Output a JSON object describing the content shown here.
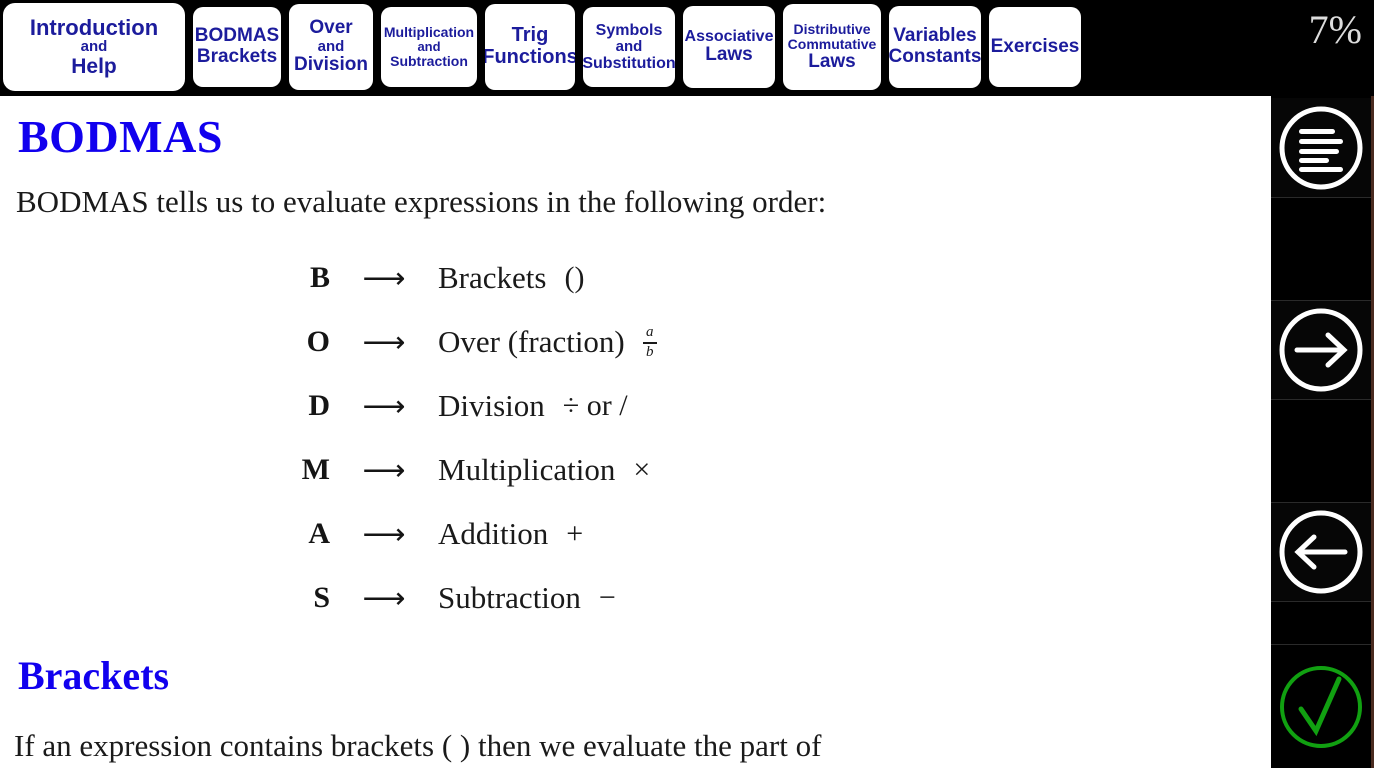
{
  "navbar": {
    "tabs": [
      {
        "id": "introduction-help",
        "lines": [
          "Introduction",
          "and",
          "Help"
        ],
        "active": true
      },
      {
        "id": "bodmas-brackets",
        "lines": [
          "BODMAS",
          "Brackets"
        ],
        "active": false
      },
      {
        "id": "over-division",
        "lines": [
          "Over",
          "and",
          "Division"
        ],
        "active": false
      },
      {
        "id": "multiplication-subtraction",
        "lines": [
          "Multiplication",
          "and",
          "Subtraction"
        ],
        "active": false
      },
      {
        "id": "trig-functions",
        "lines": [
          "Trig",
          "Functions"
        ],
        "active": false
      },
      {
        "id": "symbols-substitution",
        "lines": [
          "Symbols",
          "and",
          "Substitution"
        ],
        "active": false
      },
      {
        "id": "associative-laws",
        "lines": [
          "Associative",
          "Laws"
        ],
        "active": false
      },
      {
        "id": "distributive-commutative-laws",
        "lines": [
          "Distributive",
          "Commutative",
          "Laws"
        ],
        "active": false
      },
      {
        "id": "variables-constants",
        "lines": [
          "Variables",
          "Constants"
        ],
        "active": false
      },
      {
        "id": "exercises",
        "lines": [
          "Exercises"
        ],
        "active": false
      }
    ],
    "progress_label": "7%"
  },
  "slide": {
    "heading": "BODMAS",
    "intro": "BODMAS tells us to evaluate expressions in the following order:",
    "rows": [
      {
        "letter": "B",
        "arrow": "⟶",
        "word": "Brackets",
        "symbol": "()"
      },
      {
        "letter": "O",
        "arrow": "⟶",
        "word": "Over (fraction)",
        "symbol": "",
        "fraction": {
          "numerator": "a",
          "denominator": "b"
        }
      },
      {
        "letter": "D",
        "arrow": "⟶",
        "word": "Division",
        "symbol": "÷ or /"
      },
      {
        "letter": "M",
        "arrow": "⟶",
        "word": "Multiplication",
        "symbol": "×"
      },
      {
        "letter": "A",
        "arrow": "⟶",
        "word": "Addition",
        "symbol": "+"
      },
      {
        "letter": "S",
        "arrow": "⟶",
        "word": "Subtraction",
        "symbol": "−"
      }
    ],
    "subheading": "Brackets",
    "body_text": "If an expression contains brackets ( ) then we evaluate the part of"
  },
  "sidebar": {
    "items": [
      {
        "id": "menu",
        "icon": "hamburger-menu-icon",
        "color": "#ffffff"
      },
      {
        "id": "next",
        "icon": "arrow-right-icon",
        "color": "#ffffff"
      },
      {
        "id": "previous",
        "icon": "arrow-left-icon",
        "color": "#ffffff"
      },
      {
        "id": "check",
        "icon": "check-circle-icon",
        "color": "#11a011"
      }
    ]
  },
  "colors": {
    "tab_text": "#1c1c9c",
    "heading": "#1100ee",
    "background": "#000000",
    "content_background": "#ffffff",
    "check_green": "#11a011"
  }
}
